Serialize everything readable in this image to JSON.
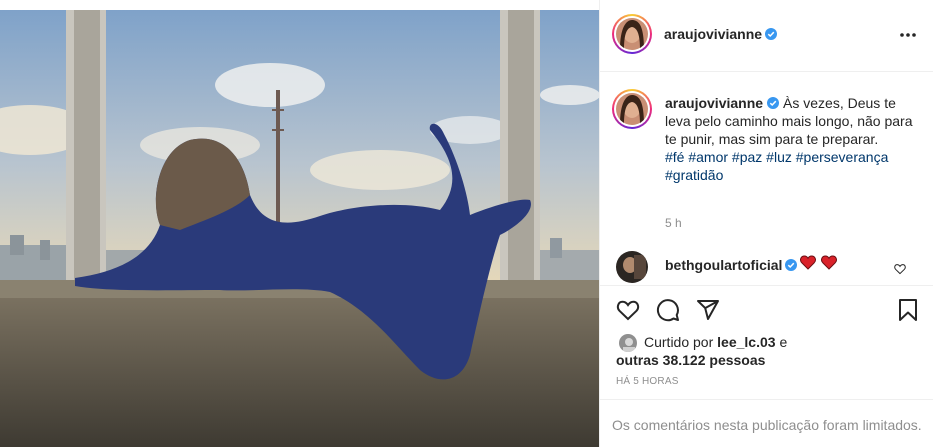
{
  "post": {
    "username": "araujovivianne",
    "caption_text": "Às vezes, Deus te leva pelo caminho mais longo, não para te punir, mas sim para te preparar.",
    "hashtags_line1": "#fé #amor #paz #luz #perseverança",
    "hashtags_line2": "#gratidão",
    "caption_age": "5 h"
  },
  "comment": {
    "username": "bethgoulartoficial",
    "text": "❤️❤️"
  },
  "likes": {
    "prefix": "Curtido por",
    "user": "lee_lc.03",
    "conjunction": "e",
    "others": "outras 38.122 pessoas"
  },
  "timestamp": "HÁ 5 HORAS",
  "comments_limited": "Os comentários nesta publicação foram limitados.",
  "icons": {
    "more": "more-options-icon",
    "like": "heart-icon",
    "comment": "comment-icon",
    "share": "share-icon",
    "save": "bookmark-icon",
    "verified": "verified-badge-icon"
  },
  "colors": {
    "verified": "#3897f0",
    "heart": "#ed4956",
    "link": "#00376b",
    "muted": "#8e8e8e"
  }
}
